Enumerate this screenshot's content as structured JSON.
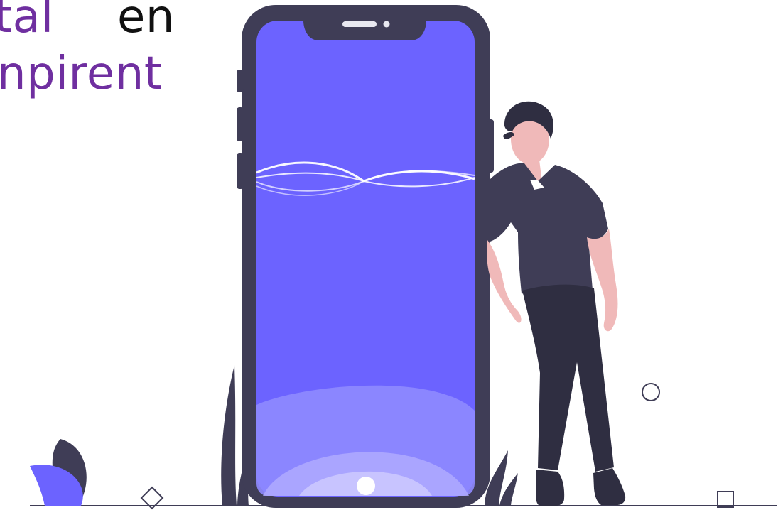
{
  "headline": {
    "line1_part1": "tal",
    "line1_part2": "en",
    "line2": "npirent"
  },
  "colors": {
    "text_purple": "#6f2fa0",
    "text_dark": "#111111",
    "phone_frame": "#3f3d56",
    "screen": "#6c63ff",
    "skin": "#f0b9b9",
    "accent": "#6c63ff",
    "wave": "#ffffff"
  },
  "icons": {
    "ground_circle": "circle-outline-icon",
    "ground_square": "square-outline-icon",
    "ground_diamond": "diamond-outline-icon"
  }
}
